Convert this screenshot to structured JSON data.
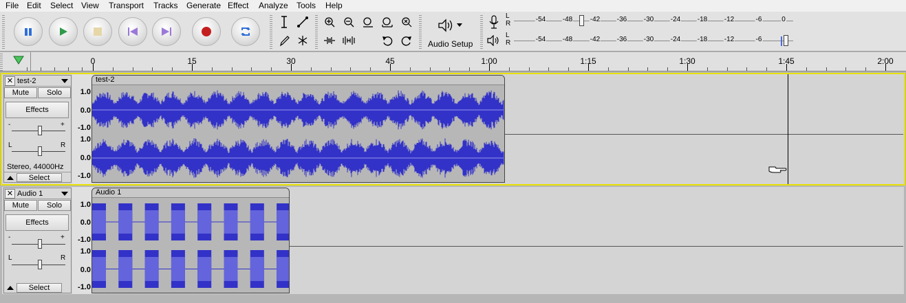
{
  "menu": [
    "File",
    "Edit",
    "Select",
    "View",
    "Transport",
    "Tracks",
    "Generate",
    "Effect",
    "Analyze",
    "Tools",
    "Help"
  ],
  "toolbar": {
    "audio_setup_label": "Audio Setup",
    "meter_scale": [
      "-54",
      "-48",
      "-42",
      "-36",
      "-30",
      "-24",
      "-18",
      "-12",
      "-6",
      "0"
    ],
    "channel_l": "L",
    "channel_r": "R"
  },
  "ruler": {
    "labels": [
      "0",
      "15",
      "30",
      "45",
      "1:00",
      "1:15",
      "1:30",
      "1:45",
      "2:00"
    ]
  },
  "tracks": [
    {
      "name": "test-2",
      "clip_name": "test-2",
      "mute_label": "Mute",
      "solo_label": "Solo",
      "effects_label": "Effects",
      "gain_minus": "-",
      "gain_plus": "+",
      "pan_l": "L",
      "pan_r": "R",
      "info": "Stereo, 44000Hz",
      "select_label": "Select",
      "scale_top": "1.0",
      "scale_mid": "0.0",
      "scale_bottom": "-1.0"
    },
    {
      "name": "Audio 1",
      "clip_name": "Audio 1",
      "mute_label": "Mute",
      "solo_label": "Solo",
      "effects_label": "Effects",
      "gain_minus": "-",
      "gain_plus": "+",
      "pan_l": "L",
      "pan_r": "R",
      "select_label": "Select",
      "scale_top": "1.0",
      "scale_mid": "0.0",
      "scale_bottom": "-1.0"
    }
  ],
  "colors": {
    "waveform": "#3232c8",
    "waveform_rms": "#6464dc",
    "selection_outline": "#e8e100"
  }
}
